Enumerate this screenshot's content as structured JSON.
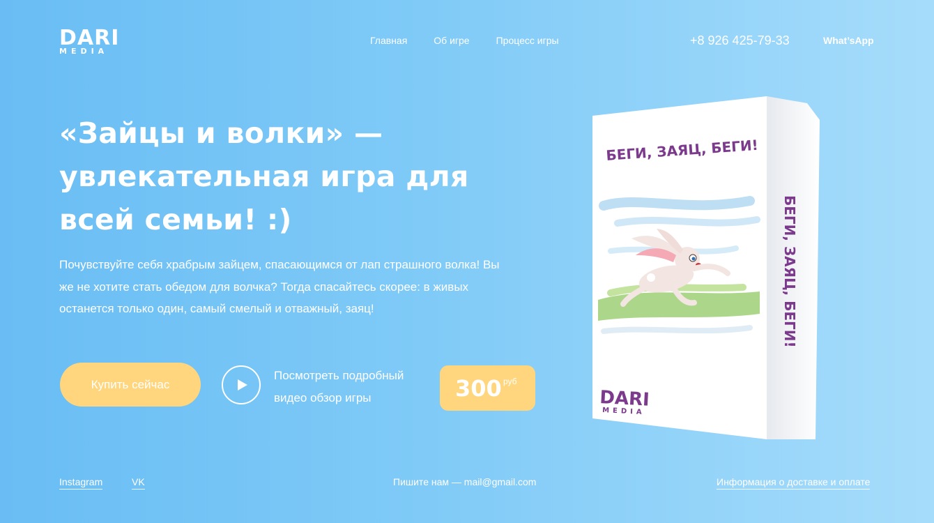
{
  "logo": {
    "top": "DARI",
    "bottom": "MEDIA"
  },
  "nav": {
    "items": [
      "Главная",
      "Об игре",
      "Процесс игры"
    ]
  },
  "header": {
    "phone": "+8 926 425-79-33",
    "whatsapp": "What’sApp"
  },
  "hero": {
    "title_line1": "«Зайцы и волки» —",
    "title_line2": "увлекательная игра для",
    "title_line3": "всей семьи! :)",
    "description": "Почувствуйте себя храбрым зайцем, спасающимся от лап страшного волка! Вы же не хотите стать обедом для волчка? Тогда спасайтесь скорее: в живых останется только один, самый смелый и отважный, заяц!",
    "buy_label": "Купить сейчас",
    "video_line1": "Посмотреть подробный",
    "video_line2": "видео обзор игры",
    "price_value": "300",
    "price_currency": "руб"
  },
  "box": {
    "front_title": "БЕГИ, ЗАЯЦ, БЕГИ!",
    "side_title": "БЕГИ, ЗАЯЦ, БЕГИ!",
    "logo_top": "DARI",
    "logo_bottom": "MEDIA"
  },
  "footer": {
    "instagram": "Instagram",
    "vk": "VK",
    "contact": "Пишите нам — mail@gmail.com",
    "delivery": "Информация о доставке и оплате"
  },
  "colors": {
    "accent_yellow": "#ffd67d",
    "box_text_purple": "#7b3a8c",
    "bg_left": "#69bdf4",
    "bg_right": "#a6dcfb"
  }
}
